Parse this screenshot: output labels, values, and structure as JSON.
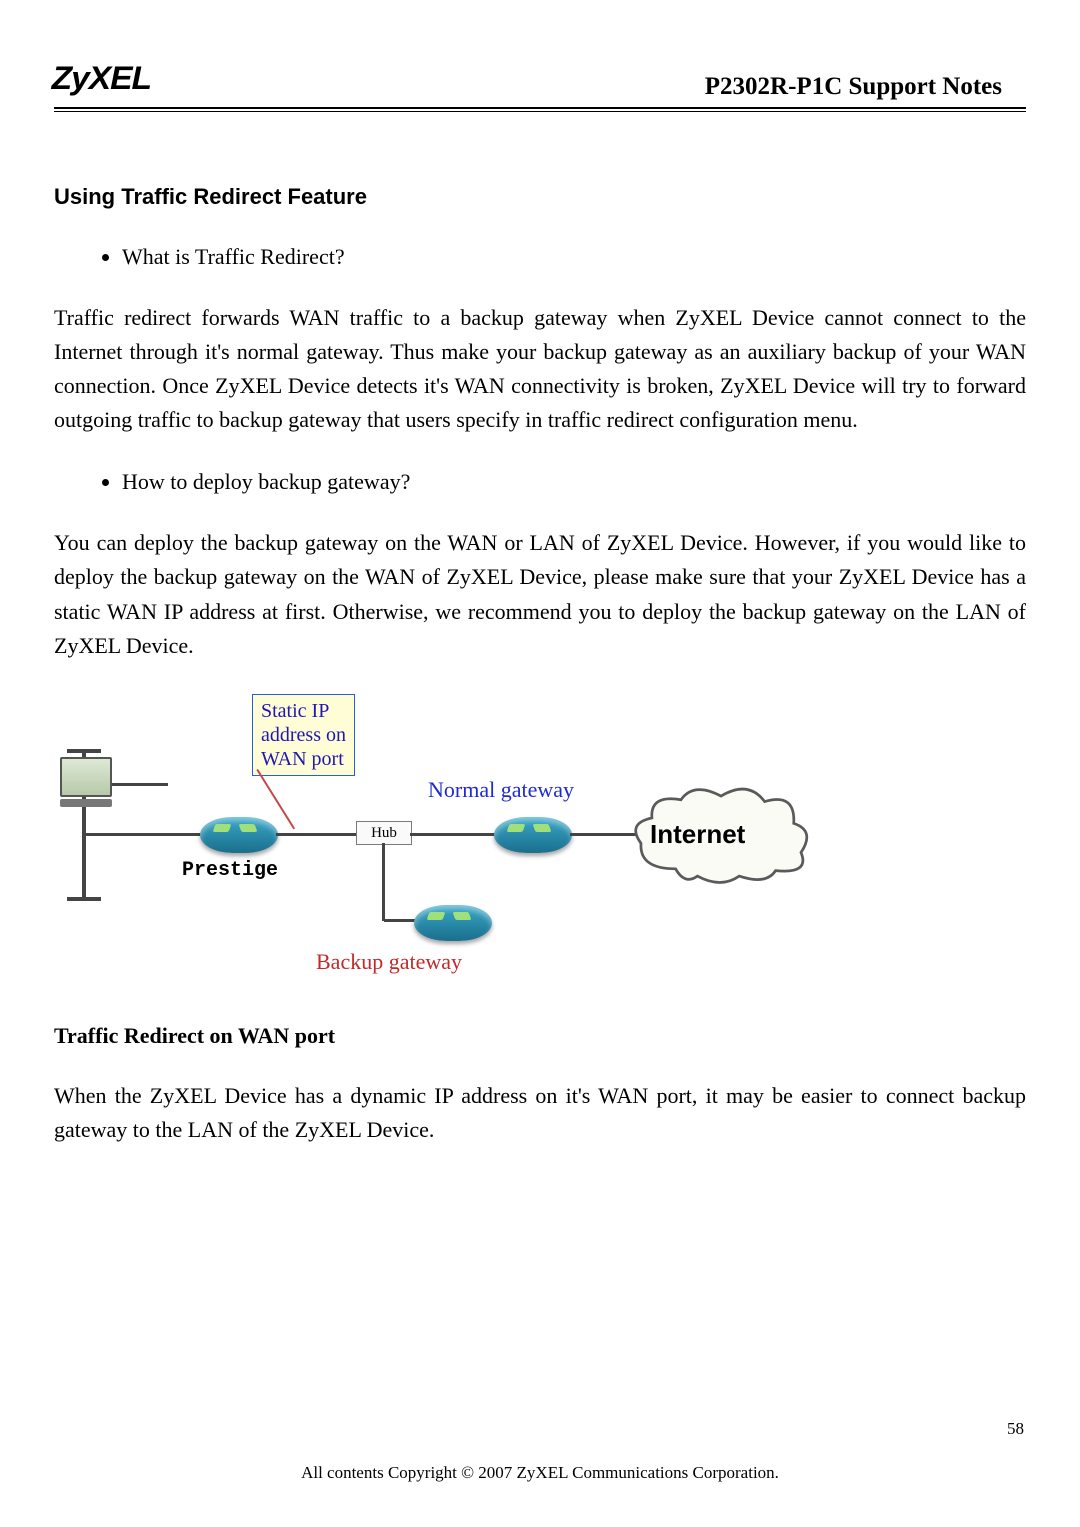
{
  "header": {
    "logo": "ZyXEL",
    "title": "P2302R-P1C Support Notes"
  },
  "section_heading": "Using Traffic Redirect Feature",
  "q1": "What is Traffic Redirect?",
  "p1": "Traffic redirect forwards WAN traffic to a backup gateway when ZyXEL Device cannot connect to the Internet through it's normal gateway. Thus make your backup gateway as an auxiliary backup of your WAN connection.   Once ZyXEL Device detects it's WAN connectivity is broken, ZyXEL Device will try to forward outgoing traffic to backup gateway that users specify in traffic redirect configuration menu.",
  "q2": "How to deploy backup gateway?",
  "p2": "You can deploy the backup gateway on the WAN or LAN of ZyXEL Device. However, if you would like to deploy the backup gateway on the WAN of ZyXEL Device, please make sure that your ZyXEL Device has a static WAN IP address at first. Otherwise, we recommend you to deploy the backup gateway on the LAN of ZyXEL Device.",
  "diagram": {
    "callout": "Static IP\naddress on\nWAN port",
    "prestige": "Prestige",
    "hub": "Hub",
    "normal_gateway": "Normal gateway",
    "backup_gateway": "Backup gateway",
    "internet": "Internet"
  },
  "subheading": "Traffic Redirect on WAN port",
  "p3": "When the ZyXEL Device has a dynamic IP address on it's WAN port, it may be easier to connect backup gateway to the LAN of the ZyXEL Device.",
  "footer": "All contents Copyright © 2007 ZyXEL Communications Corporation.",
  "page_number": "58"
}
